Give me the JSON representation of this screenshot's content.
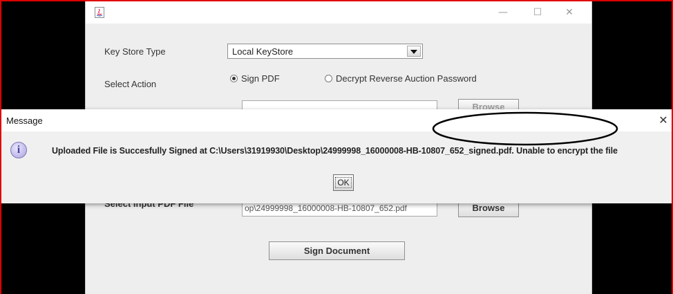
{
  "app": {
    "window_controls": {
      "minimize": "—",
      "maximize": "☐",
      "close": "✕"
    },
    "key_store_label": "Key Store Type",
    "key_store_value": "Local KeyStore",
    "select_action_label": "Select Action",
    "radio_sign_pdf": "Sign PDF",
    "radio_decrypt": "Decrypt Reverse Auction Password",
    "browse_top_label": "Browse",
    "input_pdf_label": "Select Input PDF File",
    "input_pdf_value": "op\\24999998_16000008-HB-10807_652.pdf",
    "browse_label": "Browse",
    "sign_document_label": "Sign Document"
  },
  "dialog": {
    "title": "Message",
    "close": "✕",
    "message": "Uploaded File is Succesfully Signed at C:\\Users\\31919930\\Desktop\\24999998_16000008-HB-10807_652_signed.pdf. Unable to encrypt the file",
    "ok_label": "OK"
  }
}
